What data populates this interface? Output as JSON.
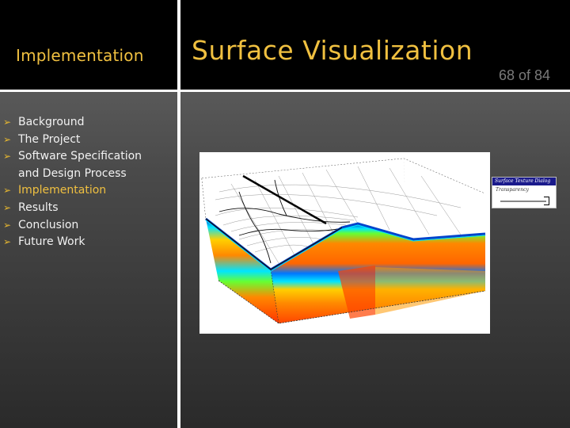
{
  "header": {
    "section_title": "Implementation",
    "slide_title": "Surface Visualization",
    "page_indicator": "68 of 84"
  },
  "outline": {
    "items": [
      {
        "label": "Background",
        "active": false
      },
      {
        "label": "The Project",
        "active": false
      },
      {
        "label": "Software Specification",
        "active": false
      },
      {
        "label": "and Design Process",
        "continuation": true
      },
      {
        "label": "Implementation",
        "active": true
      },
      {
        "label": "Results",
        "active": false
      },
      {
        "label": "Conclusion",
        "active": false
      },
      {
        "label": "Future Work",
        "active": false
      }
    ],
    "bullet_icon": "➢"
  },
  "figure": {
    "description": "3D seismic surface visualization with wireframe surface over colored cross-sections",
    "colormap": [
      "#ff3300",
      "#ff8800",
      "#ffd000",
      "#66ff33",
      "#00e5ff",
      "#0044cc"
    ]
  },
  "dialog": {
    "title": "Surface Texture Dialog",
    "label": "Transparency",
    "transparency_value": 1.0
  },
  "colors": {
    "accent": "#f0c040",
    "text": "#f2f2f2",
    "header_bg": "#000000",
    "page_num": "#7a7a7a"
  }
}
